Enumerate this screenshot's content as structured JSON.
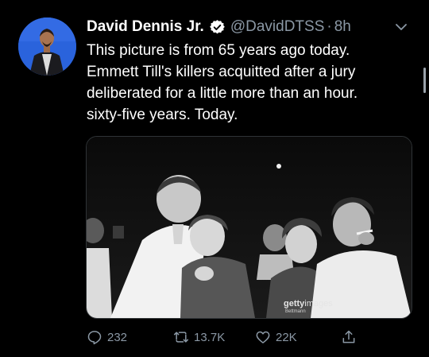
{
  "tweet": {
    "author_name": "David Dennis Jr.",
    "handle": "@DavidDTSS",
    "separator": "·",
    "time": "8h",
    "text_lines": [
      "This picture is from 65 years ago today.",
      "Emmett Till's killers  acquitted after a jury",
      "deliberated for a little more than an hour.",
      "sixty-five years. Today."
    ],
    "watermark": {
      "brand_bold": "getty",
      "brand_thin": "images",
      "credit": "Bettmann"
    },
    "actions": {
      "reply_count": "232",
      "retweet_count": "13.7K",
      "like_count": "22K"
    }
  },
  "colors": {
    "background": "#000000",
    "secondary_text": "#8b98a5",
    "verified_badge": "#ffffff"
  },
  "icons": [
    "verified-badge-icon",
    "chevron-down-icon",
    "reply-icon",
    "retweet-icon",
    "like-icon",
    "share-icon"
  ]
}
